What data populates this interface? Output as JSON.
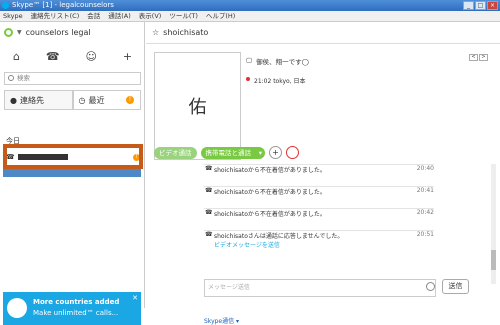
{
  "window": {
    "title": "Skype™ [1] - legalcounselors"
  },
  "menu": [
    "Skype",
    "連絡先リスト(C)",
    "会話",
    "通話(A)",
    "表示(V)",
    "ツール(T)",
    "ヘルプ(H)"
  ],
  "sidebar": {
    "user": "counselors legal",
    "search_placeholder": "検索",
    "tabs": [
      {
        "label": "連絡先"
      },
      {
        "label": "最近"
      }
    ],
    "today": "今日",
    "badge": "!"
  },
  "ad": {
    "line1": "More countries added",
    "line2": "Make unlimited™ calls...",
    "close": "✕"
  },
  "main": {
    "contact": "shoichisato",
    "mood": "御侯、翔一です◯",
    "location": "21:02 tokyo, 日本",
    "avatar_glyph": "佑",
    "pager": [
      "<",
      ">"
    ],
    "actions": {
      "video": "ビデオ通話",
      "call": "携帯電話と通話",
      "call_dd": "▾",
      "add": "+"
    },
    "messages": [
      {
        "text": "shoichisatoから不在着信がありました。",
        "time": "20:40"
      },
      {
        "text": "shoichisatoから不在着信がありました。",
        "time": "20:41"
      },
      {
        "text": "shoichisatoから不在着信がありました。",
        "time": "20:42"
      },
      {
        "text": "shoichisatoさんは通話に応答しませんでした。",
        "time": "20:51",
        "sub": "ビデオメッセージを送信"
      }
    ],
    "input_placeholder": "メッセージ送信",
    "send": "送信",
    "footer": "Skype通信 ▾"
  }
}
